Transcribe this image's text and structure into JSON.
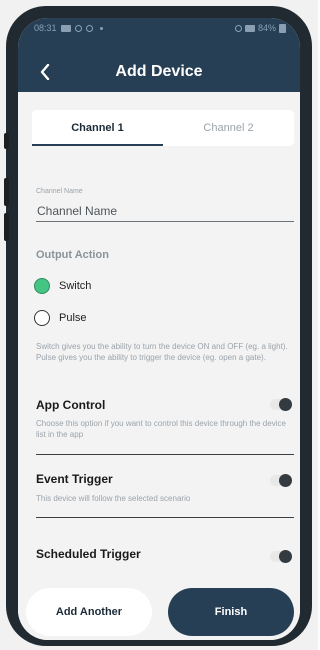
{
  "status_bar": {
    "time": "08:31",
    "battery": "84%",
    "icons": [
      "notification-icon",
      "whatsapp-icon",
      "alarm-icon",
      "wifi-icon",
      "signal-icon",
      "battery-icon"
    ]
  },
  "header": {
    "back_icon": "chevron-left-icon",
    "title": "Add Device"
  },
  "tabs": [
    {
      "label": "Channel 1",
      "active": true
    },
    {
      "label": "Channel 2",
      "active": false
    }
  ],
  "channel_name": {
    "label": "Channel Name",
    "placeholder": "Channel Name",
    "value": ""
  },
  "output_action": {
    "title": "Output Action",
    "options": [
      {
        "label": "Switch",
        "selected": true
      },
      {
        "label": "Pulse",
        "selected": false
      }
    ],
    "help": "Switch gives you the ability to turn the device ON and OFF (eg. a light).  Pulse gives you the ability to trigger the device (eg. open a gate)."
  },
  "app_control": {
    "title": "App Control",
    "description": "Choose this option if you want to control this device through the device list in the app",
    "enabled": false
  },
  "event_trigger": {
    "title": "Event Trigger",
    "description": "This device will follow the selected scenario",
    "enabled": false
  },
  "scheduled_trigger": {
    "title": "Scheduled Trigger",
    "enabled": false
  },
  "footer": {
    "add_another_label": "Add Another",
    "finish_label": "Finish"
  },
  "colors": {
    "header": "#263f55",
    "accent_green": "#44c583",
    "background": "#f3f3f3"
  }
}
